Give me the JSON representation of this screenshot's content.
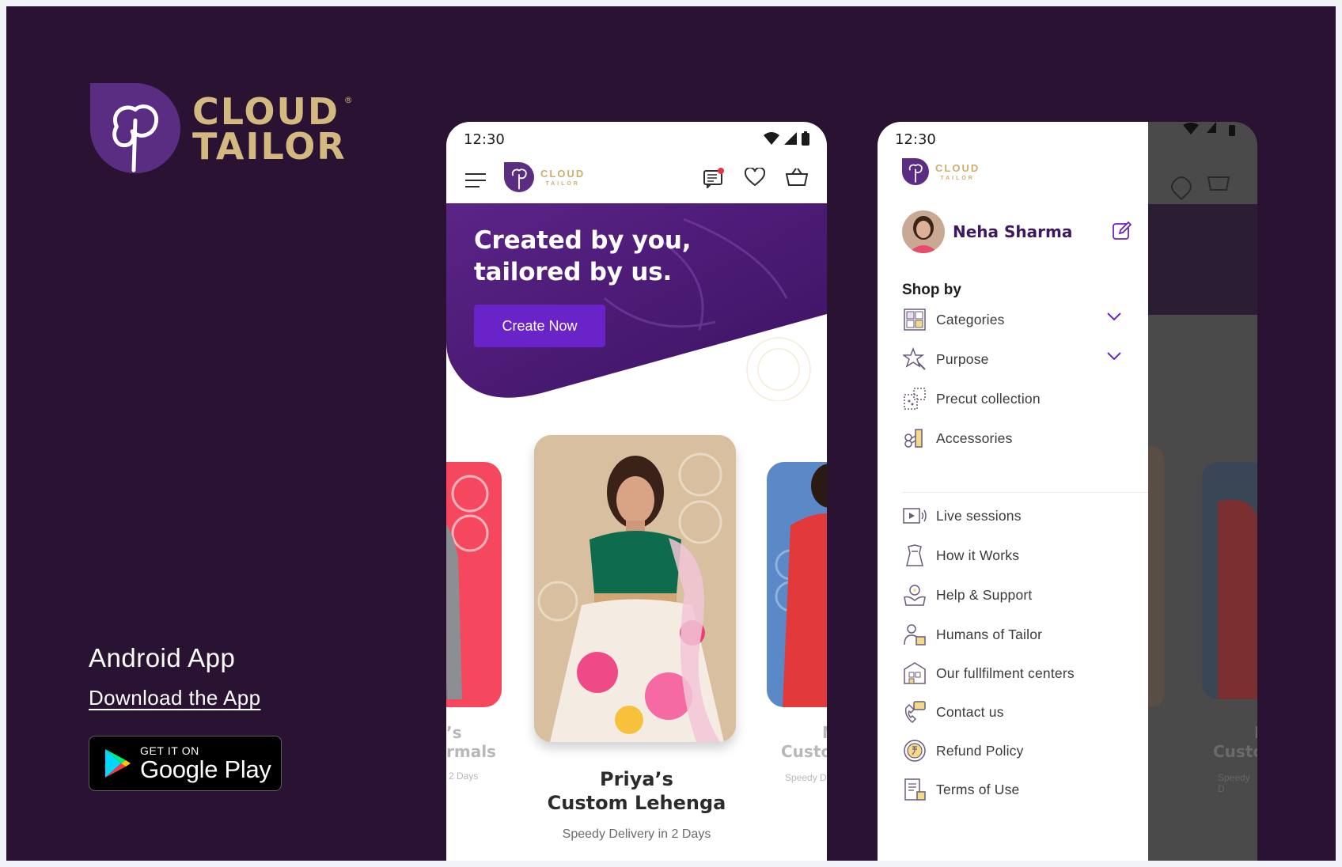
{
  "brand": {
    "line1": "CLOUD",
    "line2": "TAILOR",
    "registered": "®"
  },
  "left": {
    "android_title": "Android App",
    "download_link": "Download the App",
    "badge": {
      "small": "GET IT ON",
      "large": "Google Play"
    }
  },
  "phone1": {
    "status_time": "12:30",
    "logo": {
      "top": "CLOUD",
      "bottom": "TAILOR"
    },
    "hero": {
      "title_line1": "Created by you,",
      "title_line2": "tailored by us.",
      "button": "Create Now"
    },
    "card": {
      "title_line1": "Priya’s",
      "title_line2": "Custom Lehenga",
      "subtitle": "Speedy Delivery in 2 Days"
    },
    "left_card": {
      "title_partial_1": "’s",
      "title_partial_2": "rmals",
      "subtitle_partial": "2 Days"
    },
    "right_card": {
      "title_partial_1": "N",
      "title_partial_2": "Custo",
      "subtitle_partial": "Speedy D"
    }
  },
  "phone2": {
    "status_time": "12:30",
    "logo": {
      "top": "CLOUD",
      "bottom": "TAILOR"
    },
    "profile_name": "Neha Sharma",
    "shop_by": "Shop by",
    "shop_items": [
      {
        "label": "Categories",
        "icon": "categories-icon",
        "expandable": true
      },
      {
        "label": "Purpose",
        "icon": "purpose-icon",
        "expandable": true
      },
      {
        "label": "Precut collection",
        "icon": "precut-icon",
        "expandable": false
      },
      {
        "label": "Accessories",
        "icon": "accessories-icon",
        "expandable": false
      }
    ],
    "info_items": [
      {
        "label": "Live sessions",
        "icon": "live-sessions-icon"
      },
      {
        "label": "How it Works",
        "icon": "how-it-works-icon"
      },
      {
        "label": "Help & Support",
        "icon": "help-support-icon"
      },
      {
        "label": "Humans of Tailor",
        "icon": "humans-of-tailor-icon"
      },
      {
        "label": "Our fullfilment centers",
        "icon": "fulfilment-centers-icon"
      },
      {
        "label": "Contact us",
        "icon": "contact-us-icon"
      },
      {
        "label": "Refund Policy",
        "icon": "refund-policy-icon"
      },
      {
        "label": "Terms of Use",
        "icon": "terms-of-use-icon"
      }
    ],
    "behind": {
      "title_partial_1": "N",
      "title_partial_2": "Custo",
      "subtitle_partial": "Speedy D"
    }
  },
  "colors": {
    "background": "#2a1232",
    "gold": "#d3b97f",
    "purple": "#6a23c8",
    "deep_purple": "#3d1760"
  }
}
